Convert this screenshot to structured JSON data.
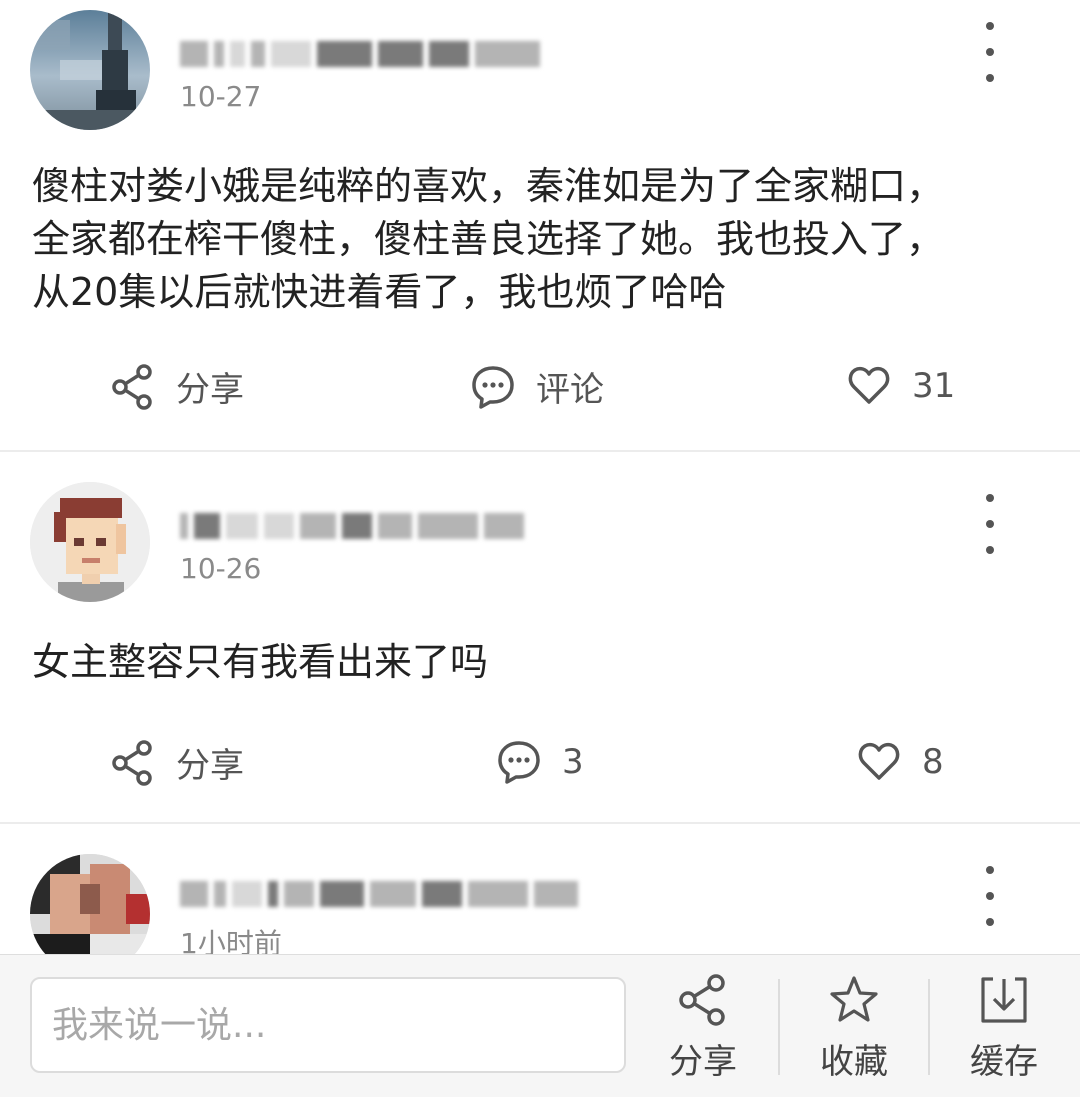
{
  "posts": [
    {
      "date": "10-27",
      "text": "傻柱对娄小娥是纯粹的喜欢，秦淮如是为了全家糊口，\n全家都在榨干傻柱，傻柱善良选择了她。我也投入了，\n从20集以后就快进着看了，我也烦了哈哈",
      "share_label": "分享",
      "comment_label": "评论",
      "like_count": "31"
    },
    {
      "date": "10-26",
      "text": "女主整容只有我看出来了吗",
      "share_label": "分享",
      "comment_count": "3",
      "like_count": "8"
    },
    {
      "date": "1小时前"
    }
  ],
  "bottom_bar": {
    "comment_placeholder": "我来说一说...",
    "share_label": "分享",
    "favorite_label": "收藏",
    "download_label": "缓存"
  },
  "icons": {
    "share": "share-icon",
    "comment": "comment-icon",
    "like": "heart-icon",
    "more": "more-vertical-icon",
    "favorite": "star-icon",
    "download": "download-icon"
  },
  "colors": {
    "text_primary": "#222222",
    "text_secondary": "#8a8a8a",
    "icon_gray": "#555555",
    "divider": "#ececec",
    "bar_background": "#f6f6f6"
  }
}
